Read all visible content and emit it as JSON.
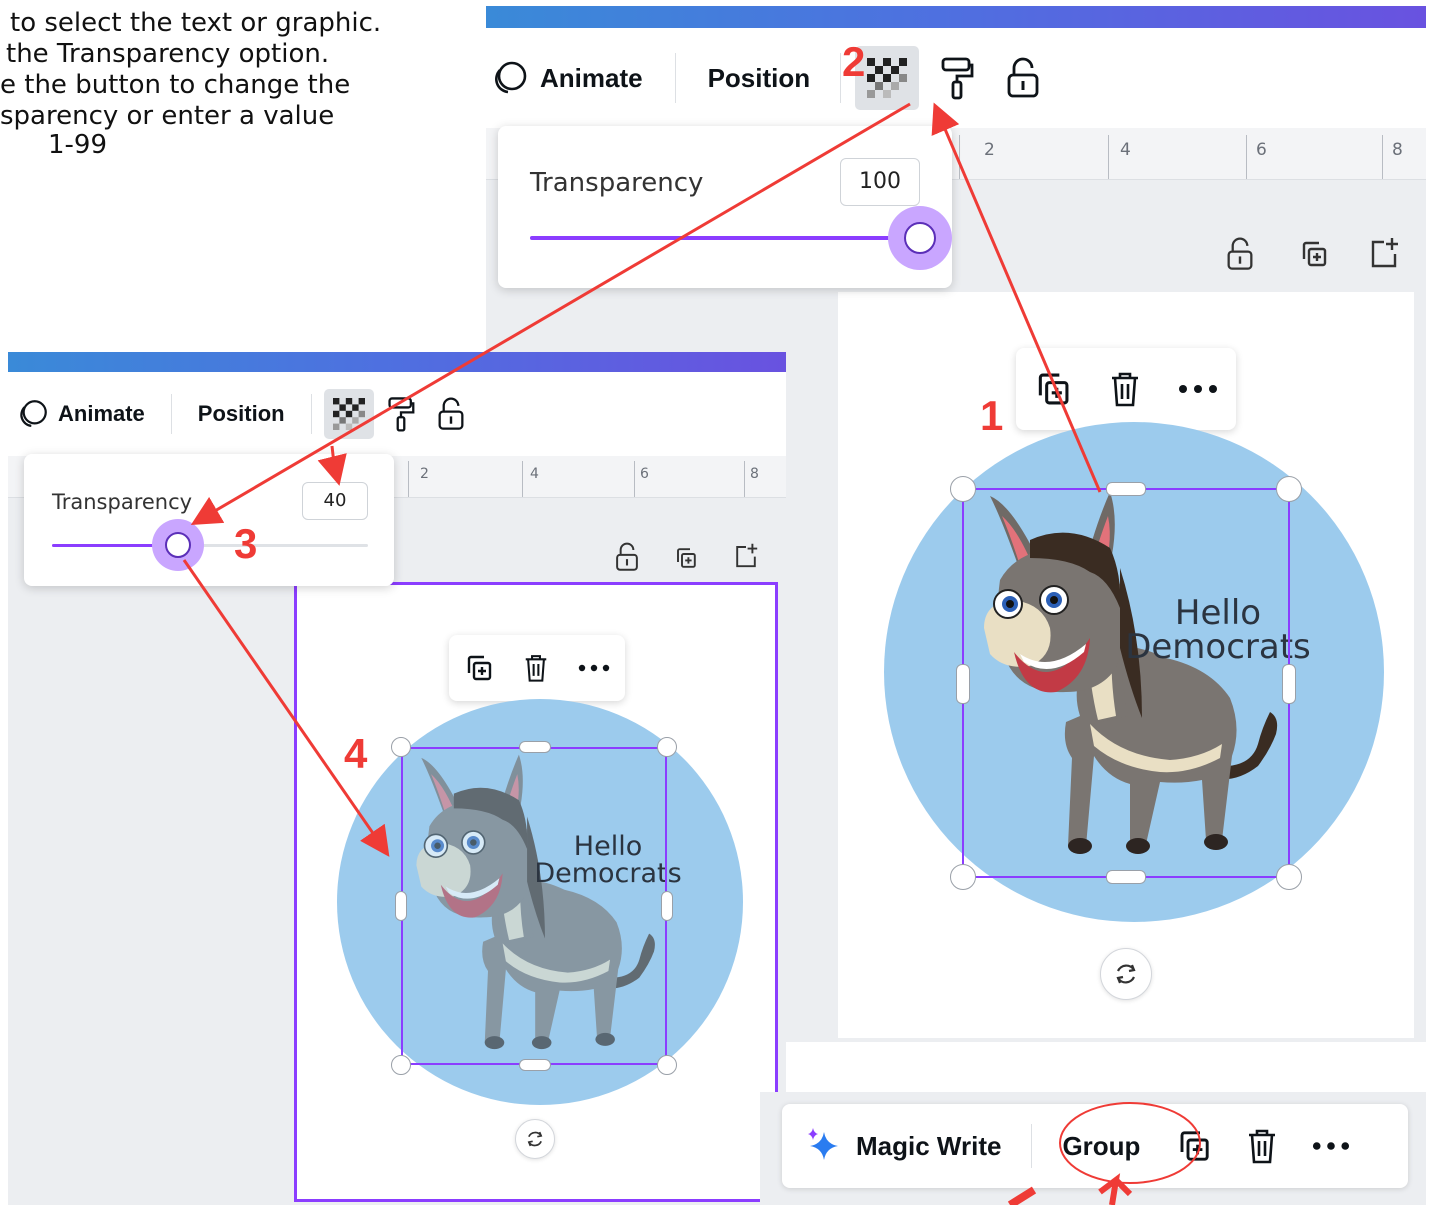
{
  "instructions": {
    "line1": "to select the text or graphic.",
    "line2": " the Transparency option.",
    "line3": "e the button to change the",
    "line4": "sparency or enter a value",
    "line5": " 1-99"
  },
  "steps": [
    "1",
    "2",
    "3",
    "4"
  ],
  "panel_large": {
    "toolbar": {
      "animate_label": "Animate",
      "position_label": "Position"
    },
    "ruler_numbers": [
      "2",
      "4",
      "6",
      "8"
    ],
    "transparency_popup": {
      "label": "Transparency",
      "value": "100",
      "slider_value": 100
    },
    "caption": {
      "line1": "Hello",
      "line2": "Democrats"
    }
  },
  "panel_small": {
    "toolbar": {
      "animate_label": "Animate",
      "position_label": "Position"
    },
    "ruler_numbers": [
      "2",
      "4",
      "6",
      "8"
    ],
    "transparency_popup": {
      "label": "Transparency",
      "value": "40",
      "slider_value": 40
    },
    "caption": {
      "line1": "Hello",
      "line2": "Democrats"
    }
  },
  "bottom_toolbar": {
    "magic_write_label": "Magic Write",
    "group_label": "Group"
  },
  "colors": {
    "accent": "#8b3dff",
    "annotation": "#ef3b36",
    "circle": "#9ccbed"
  }
}
